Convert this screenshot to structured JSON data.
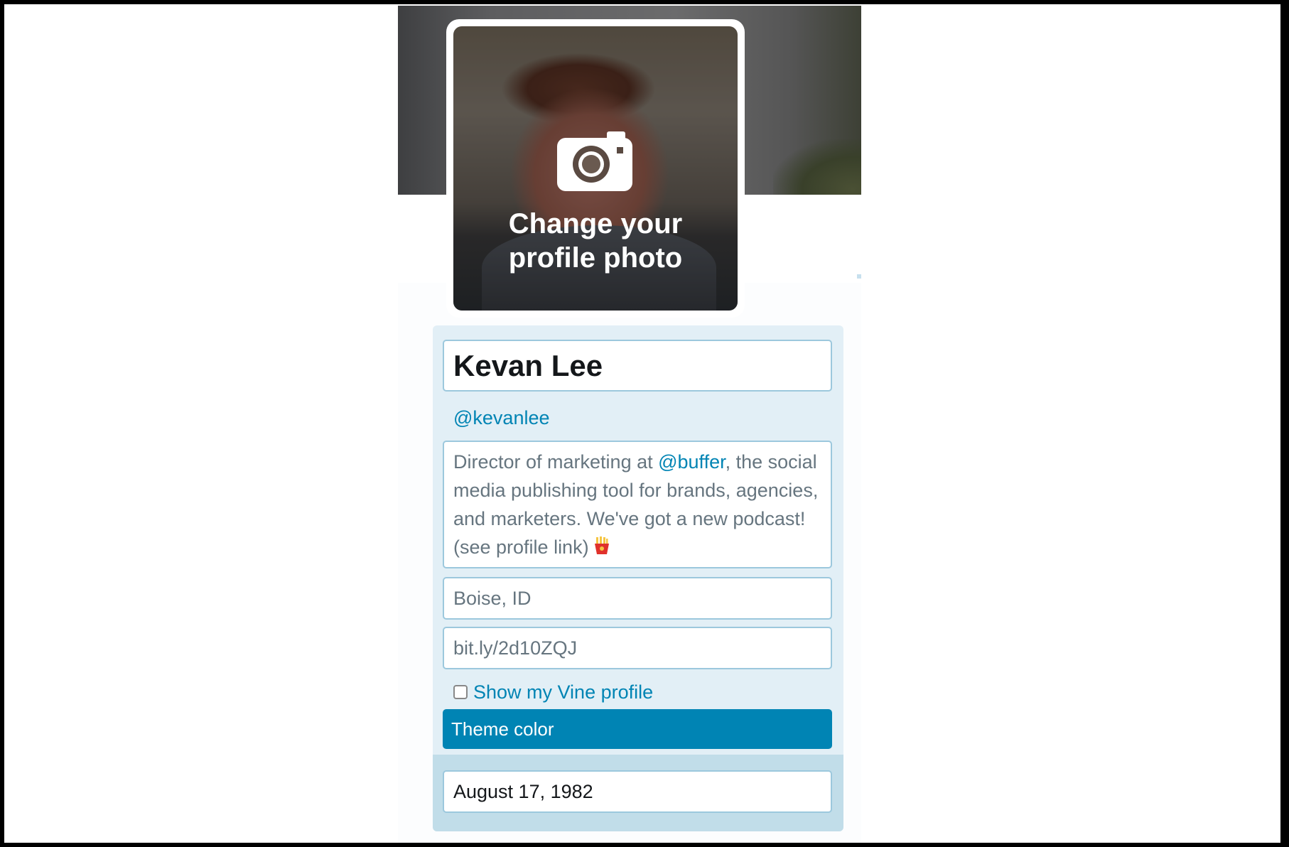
{
  "avatar": {
    "change_label_line1": "Change your",
    "change_label_line2": "profile photo",
    "icon": "camera-icon"
  },
  "profile": {
    "name": "Kevan Lee",
    "handle": "@kevanlee",
    "bio_before": "Director of marketing at ",
    "bio_mention": "@buffer",
    "bio_after": ", the social media publishing tool for brands, agencies, and marketers. We've got a new podcast! (see profile link) ",
    "bio_emoji": "french-fries-emoji",
    "location": "Boise, ID",
    "website": "bit.ly/2d10ZQJ",
    "vine_label": "Show my Vine profile",
    "vine_checked": false,
    "theme_label": "Theme color",
    "birthdate": "August 17, 1982"
  },
  "colors": {
    "accent": "#0084b4",
    "panel_bg": "#e2eff6",
    "panel_footer_bg": "#c1dde9",
    "field_border": "#9cc8dd"
  }
}
